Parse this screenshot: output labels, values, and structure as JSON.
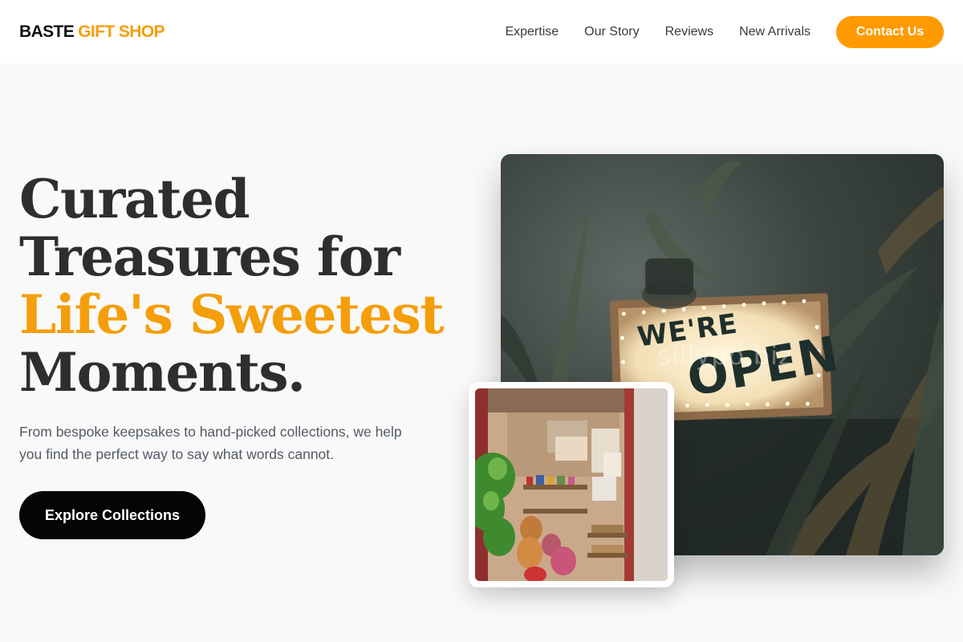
{
  "header": {
    "logo_part1": "BASTE",
    "logo_part2": "GIFT SHOP",
    "nav": [
      "Expertise",
      "Our Story",
      "Reviews",
      "New Arrivals"
    ],
    "contact_label": "Contact Us"
  },
  "hero": {
    "title_line1": "Curated",
    "title_line2": "Treasures for",
    "title_accent": "Life's Sweetest",
    "title_line4": "Moments.",
    "subtitle": "From bespoke keepsakes to hand-picked collections, we help you find the perfect way to say what words cannot.",
    "cta_label": "Explore Collections"
  },
  "images": {
    "main_sign_line1": "WE'RE",
    "main_sign_line2": "OPEN",
    "main_watermark": "sillypo.biz"
  },
  "colors": {
    "accent": "#f59e0b",
    "contact_button": "#ff9a00",
    "cta_button": "#050505",
    "background": "#f9f9f9"
  }
}
